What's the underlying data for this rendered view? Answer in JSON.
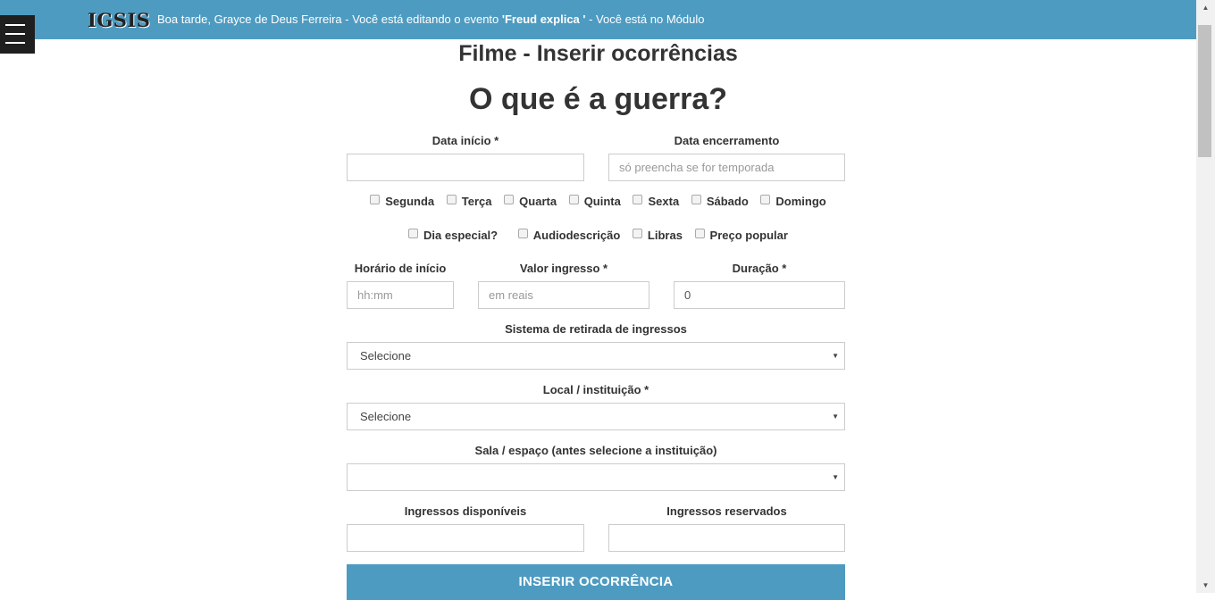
{
  "header": {
    "logo": "IGSIS",
    "greeting_pre": "Boa tarde, Grayce de Deus Ferreira - Você está editando o evento ",
    "event_name": "'Freud explica '",
    "greeting_post": " - Você está no Módulo"
  },
  "page": {
    "title": "Filme - Inserir ocorrências",
    "event_title": "O que é a guerra?"
  },
  "form": {
    "data_inicio_label": "Data início *",
    "data_inicio_value": "",
    "data_encerramento_label": "Data encerramento",
    "data_encerramento_placeholder": "só preencha se for temporada",
    "weekdays": [
      "Segunda",
      "Terça",
      "Quarta",
      "Quinta",
      "Sexta",
      "Sábado",
      "Domingo"
    ],
    "specials": [
      "Dia especial?",
      "Audiodescrição",
      "Libras",
      "Preço popular"
    ],
    "horario_label": "Horário de início",
    "horario_placeholder": "hh:mm",
    "valor_label": "Valor ingresso *",
    "valor_placeholder": "em reais",
    "duracao_label": "Duração *",
    "duracao_value": "0",
    "retirada_label": "Sistema de retirada de ingressos",
    "retirada_value": "Selecione",
    "local_label": "Local / instituição *",
    "local_value": "Selecione",
    "sala_label": "Sala / espaço (antes selecione a instituição)",
    "sala_value": "",
    "disponiveis_label": "Ingressos disponíveis",
    "reservados_label": "Ingressos reservados",
    "submit_label": "INSERIR OCORRÊNCIA"
  }
}
